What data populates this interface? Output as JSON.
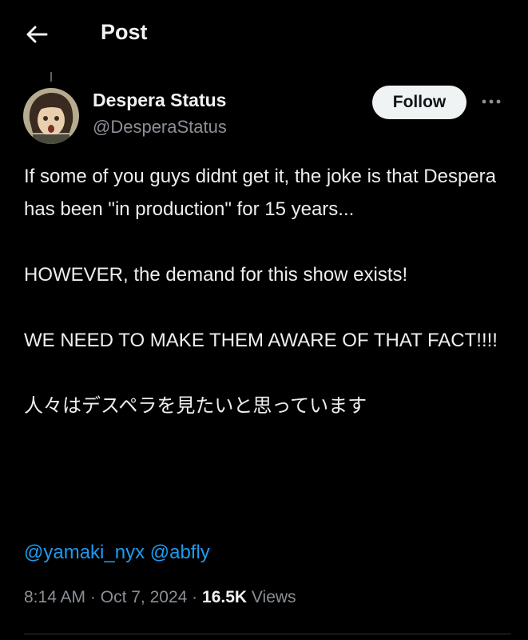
{
  "header": {
    "title": "Post",
    "back_icon": "arrow-left-icon"
  },
  "author": {
    "name": "Despera Status",
    "handle": "@DesperaStatus",
    "follow_label": "Follow",
    "more_icon": "more-horizontal-icon"
  },
  "post": {
    "paragraphs": [
      "If some of you guys didnt get it, the joke is that Despera has been \"in production\" for 15 years...",
      "HOWEVER, the demand for this show exists!",
      "WE NEED TO MAKE THEM AWARE OF THAT FACT!!!!",
      "人々はデスペラを見たいと思っています"
    ],
    "mentions": [
      "@yamaki_nyx",
      "@abfly"
    ]
  },
  "meta": {
    "time": "8:14 AM",
    "separator": "·",
    "date": "Oct 7, 2024",
    "views_count": "16.5K",
    "views_label": "Views"
  },
  "colors": {
    "background": "#000000",
    "text": "#e7e9ea",
    "muted": "#8b9096",
    "link": "#1d9bf0",
    "follow_bg": "#eff3f4"
  }
}
